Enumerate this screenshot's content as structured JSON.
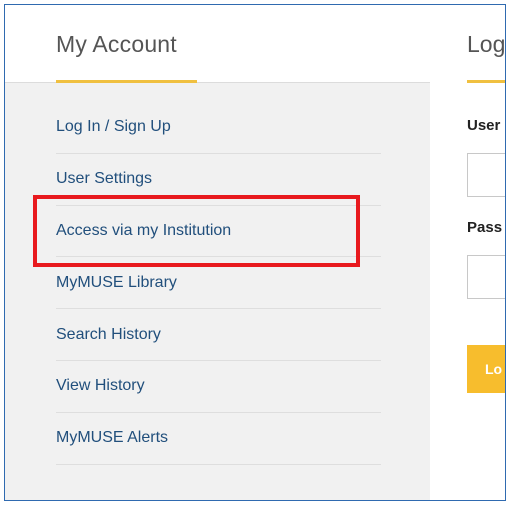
{
  "sidebar": {
    "title": "My Account",
    "items": [
      {
        "label": "Log In / Sign Up"
      },
      {
        "label": "User Settings"
      },
      {
        "label": "Access via my Institution"
      },
      {
        "label": "MyMUSE Library"
      },
      {
        "label": "Search History"
      },
      {
        "label": "View History"
      },
      {
        "label": "MyMUSE Alerts"
      }
    ],
    "highlighted_item": "Access via my Institution"
  },
  "main": {
    "title": "Log",
    "username_label": "User",
    "username_value": "",
    "password_label": "Pass",
    "password_value": "",
    "login_button_label": "Lo"
  },
  "colors": {
    "accent": "#f0c040",
    "link": "#214f7c",
    "highlight_box": "#e8191e",
    "button": "#f7bd2d"
  }
}
